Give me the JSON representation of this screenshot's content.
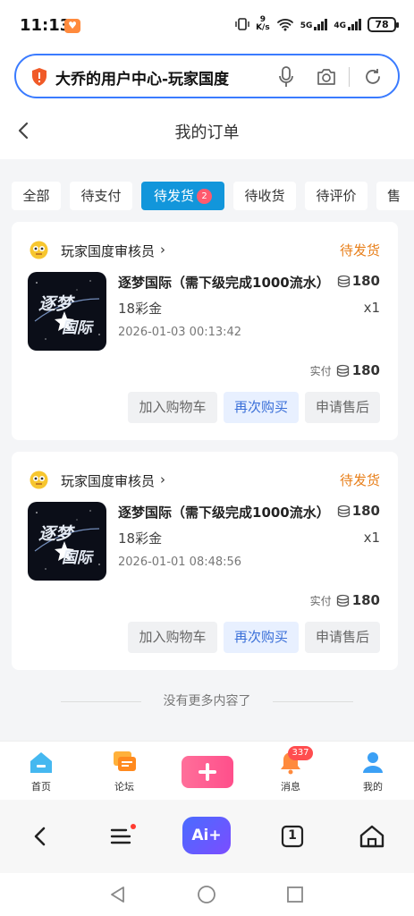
{
  "status_bar": {
    "time": "11:13",
    "net_speed_value": "9",
    "net_speed_unit": "K/s",
    "network_5g": "5G",
    "network_4g": "4G",
    "battery": "78"
  },
  "url_bar": {
    "text": "大乔的用户中心-玩家国度"
  },
  "page": {
    "title": "我的订单"
  },
  "tabs": [
    {
      "label": "全部"
    },
    {
      "label": "待支付"
    },
    {
      "label": "待发货",
      "badge": "2"
    },
    {
      "label": "待收货"
    },
    {
      "label": "待评价"
    },
    {
      "label": "售"
    }
  ],
  "orders": [
    {
      "shop": "玩家国度审核员",
      "status": "待发货",
      "product_name": "逐梦国际（需下级完成1000流水）",
      "price": "180",
      "spec": "18彩金",
      "qty": "x1",
      "time": "2026-01-03 00:13:42",
      "paid_label": "实付",
      "paid_value": "180",
      "image_text_1": "逐梦",
      "image_text_2": "国际",
      "btn_cart": "加入购物车",
      "btn_rebuy": "再次购买",
      "btn_after_sale": "申请售后"
    },
    {
      "shop": "玩家国度审核员",
      "status": "待发货",
      "product_name": "逐梦国际（需下级完成1000流水）",
      "price": "180",
      "spec": "18彩金",
      "qty": "x1",
      "time": "2026-01-01 08:48:56",
      "paid_label": "实付",
      "paid_value": "180",
      "image_text_1": "逐梦",
      "image_text_2": "国际",
      "btn_cart": "加入购物车",
      "btn_rebuy": "再次购买",
      "btn_after_sale": "申请售后"
    }
  ],
  "no_more": "没有更多内容了",
  "app_nav": {
    "items": [
      {
        "label": "首页",
        "icon": "home-icon"
      },
      {
        "label": "论坛",
        "icon": "forum-icon"
      },
      {
        "label": "",
        "icon": "plus-icon"
      },
      {
        "label": "消息",
        "icon": "bell-icon",
        "badge": "337"
      },
      {
        "label": "我的",
        "icon": "user-icon"
      }
    ]
  },
  "browser_bar": {
    "ai_label": "Ai+",
    "tab_count": "1"
  },
  "colors": {
    "accent_blue": "#1296db",
    "status_orange": "#e87f1a",
    "badge_red": "#ff4d4f",
    "rebuy_blue": "#3a6fd8"
  }
}
